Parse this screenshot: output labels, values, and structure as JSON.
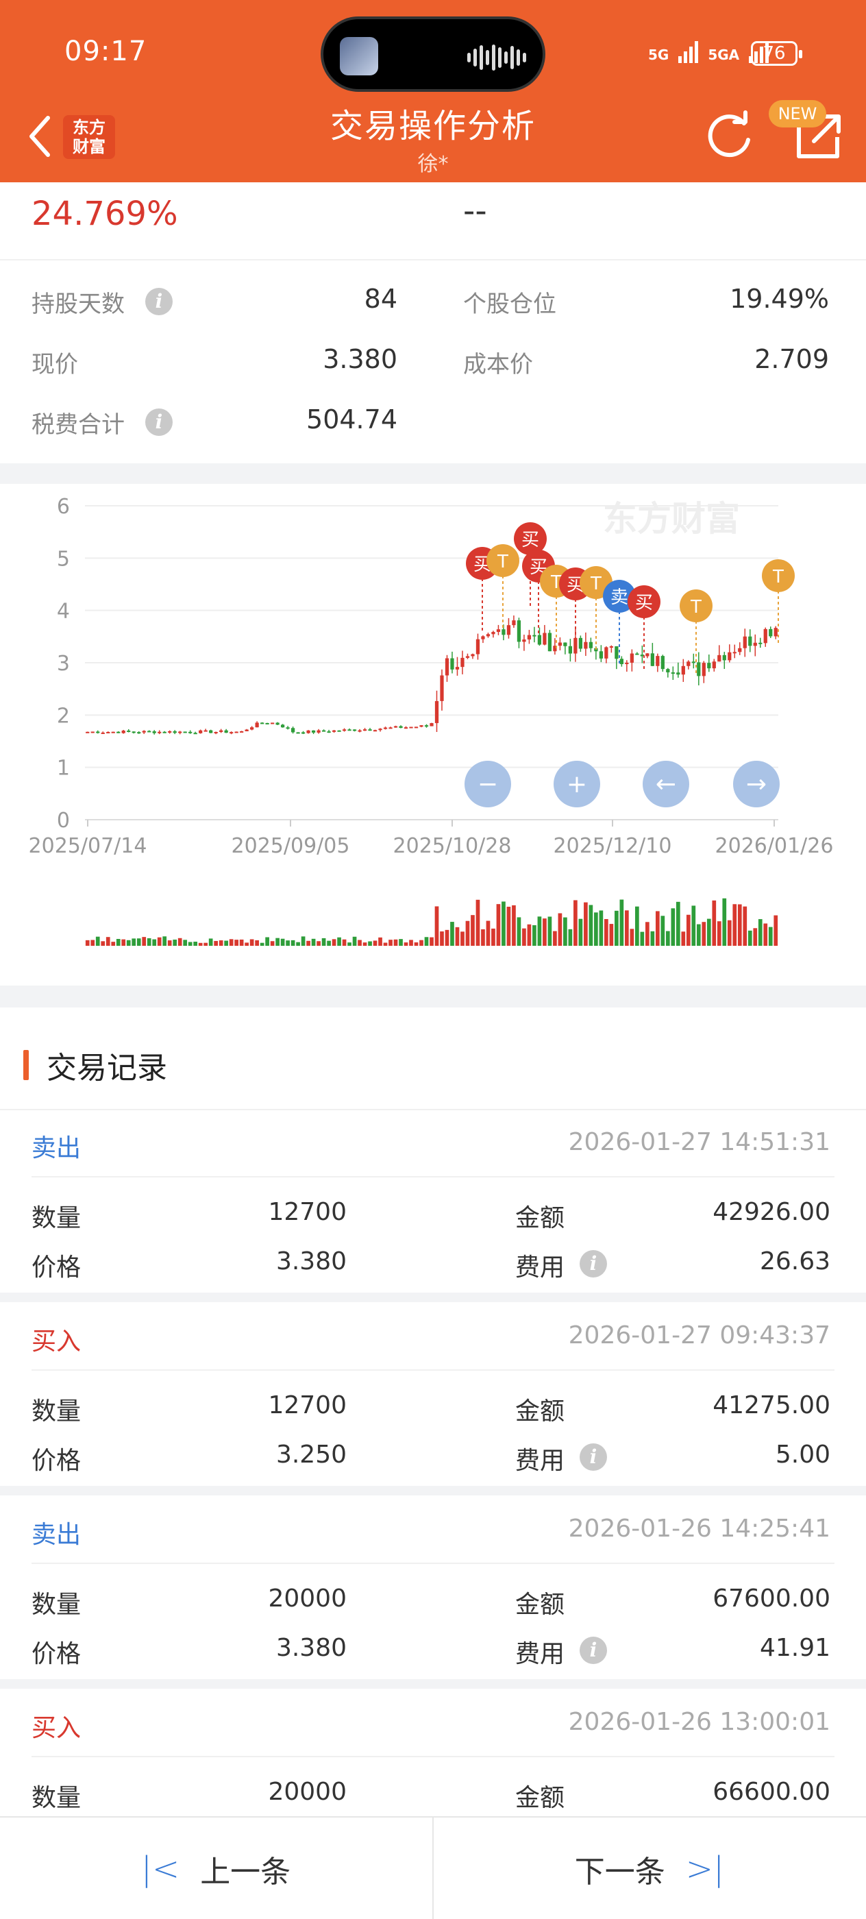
{
  "status_bar": {
    "time": "09:17",
    "net1": "5G",
    "net2": "5GA",
    "battery": "76"
  },
  "header": {
    "logo_line1": "东方",
    "logo_line2": "财富",
    "title": "交易操作分析",
    "subtitle": "徐*",
    "new_badge": "NEW"
  },
  "summary": {
    "return_pct": "24.769%",
    "second_value": "--",
    "holding_days_label": "持股天数",
    "holding_days": "84",
    "position_label": "个股仓位",
    "position": "19.49%",
    "price_label": "现价",
    "price": "3.380",
    "cost_label": "成本价",
    "cost": "2.709",
    "fees_label": "税费合计",
    "fees": "504.74"
  },
  "chart_data": {
    "type": "candlestick",
    "watermark": "东方财富",
    "y_ticks": [
      "6",
      "5",
      "4",
      "3",
      "2",
      "1",
      "0"
    ],
    "ylim": [
      0,
      6
    ],
    "x_labels": [
      "2025/07/14",
      "2025/09/05",
      "2025/10/28",
      "2025/12/10",
      "2026/01/26"
    ],
    "markers": [
      "买",
      "T",
      "买",
      "买",
      "T",
      "买",
      "T",
      "卖",
      "买",
      "T",
      "T"
    ],
    "controls": [
      "zoom-out",
      "zoom-in",
      "pan-left",
      "pan-right"
    ]
  },
  "records": {
    "title": "交易记录",
    "qty_label": "数量",
    "amount_label": "金额",
    "price_label": "价格",
    "fee_label": "费用",
    "items": [
      {
        "type": "卖出",
        "kind": "sell",
        "time": "2026-01-27 14:51:31",
        "qty": "12700",
        "amount": "42926.00",
        "price": "3.380",
        "fee": "26.63"
      },
      {
        "type": "买入",
        "kind": "buy",
        "time": "2026-01-27 09:43:37",
        "qty": "12700",
        "amount": "41275.00",
        "price": "3.250",
        "fee": "5.00"
      },
      {
        "type": "卖出",
        "kind": "sell",
        "time": "2026-01-26 14:25:41",
        "qty": "20000",
        "amount": "67600.00",
        "price": "3.380",
        "fee": "41.91"
      },
      {
        "type": "买入",
        "kind": "buy",
        "time": "2026-01-26 13:00:01",
        "qty": "20000",
        "amount": "66600.00"
      }
    ]
  },
  "bottom_nav": {
    "prev": "上一条",
    "next": "下一条"
  },
  "colors": {
    "accent": "#ec5f2c",
    "up": "#d8382e",
    "down": "#2e9d3a",
    "sell": "#3a7bd5",
    "t_marker": "#e8a33b"
  }
}
